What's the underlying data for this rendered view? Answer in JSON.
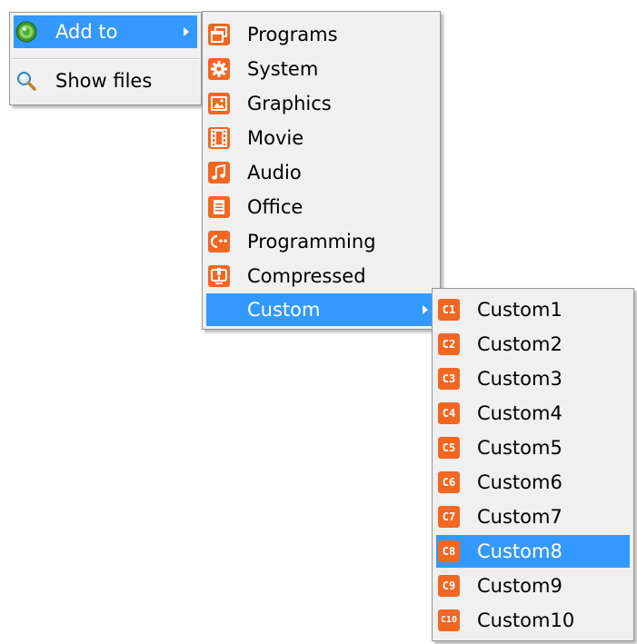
{
  "menu_main": {
    "items": [
      {
        "label": "Add to",
        "icon": "green-globe-icon"
      },
      {
        "label": "Show files",
        "icon": "magnifier-icon"
      }
    ]
  },
  "menu_add_to": {
    "items": [
      {
        "label": "Programs",
        "icon": "window-icon"
      },
      {
        "label": "System",
        "icon": "gear-icon"
      },
      {
        "label": "Graphics",
        "icon": "picture-icon"
      },
      {
        "label": "Movie",
        "icon": "film-icon"
      },
      {
        "label": "Audio",
        "icon": "music-note-icon"
      },
      {
        "label": "Office",
        "icon": "document-icon"
      },
      {
        "label": "Programming",
        "icon": "code-icon"
      },
      {
        "label": "Compressed",
        "icon": "archive-icon"
      },
      {
        "label": "Custom",
        "icon": ""
      }
    ]
  },
  "menu_custom": {
    "items": [
      {
        "label": "Custom1",
        "badge": "C1"
      },
      {
        "label": "Custom2",
        "badge": "C2"
      },
      {
        "label": "Custom3",
        "badge": "C3"
      },
      {
        "label": "Custom4",
        "badge": "C4"
      },
      {
        "label": "Custom5",
        "badge": "C5"
      },
      {
        "label": "Custom6",
        "badge": "C6"
      },
      {
        "label": "Custom7",
        "badge": "C7"
      },
      {
        "label": "Custom8",
        "badge": "C8"
      },
      {
        "label": "Custom9",
        "badge": "C9"
      },
      {
        "label": "Custom10",
        "badge": "C10"
      }
    ]
  },
  "colors": {
    "highlight": "#3399ff",
    "menu_bg": "#f0f0f0",
    "icon_orange": "#f26722"
  }
}
